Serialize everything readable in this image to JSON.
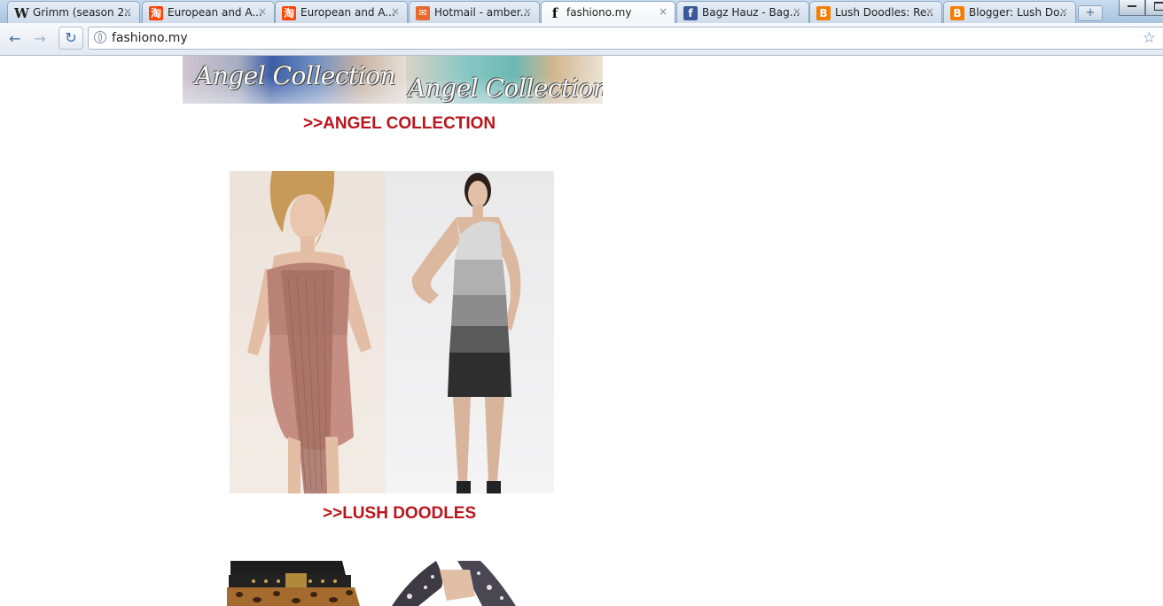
{
  "browser": {
    "tabs": [
      {
        "title": "Grimm (season 2...",
        "favicon": "wikipedia-icon",
        "fav_text": "W",
        "active": false
      },
      {
        "title": "European and A...",
        "favicon": "taobao-icon",
        "fav_text": "淘",
        "active": false
      },
      {
        "title": "European and A...",
        "favicon": "taobao-icon",
        "fav_text": "淘",
        "active": false
      },
      {
        "title": "Hotmail - amber...",
        "favicon": "hotmail-icon",
        "fav_text": "✉",
        "active": false
      },
      {
        "title": "fashiono.my",
        "favicon": "fashiono-icon",
        "fav_text": "f",
        "active": true
      },
      {
        "title": "Bagz Hauz - Bag...",
        "favicon": "facebook-icon",
        "fav_text": "f",
        "active": false
      },
      {
        "title": "Lush Doodles: Re...",
        "favicon": "blogger-icon",
        "fav_text": "B",
        "active": false
      },
      {
        "title": "Blogger: Lush Do...",
        "favicon": "blogger-icon",
        "fav_text": "B",
        "active": false
      }
    ],
    "close_glyph": "×",
    "new_tab_glyph": "+",
    "url": "fashiono.my",
    "colors": {
      "facebook": "#3b5998",
      "blogger": "#f57d00",
      "taobao": "#ff4400",
      "hotmail": "#e8692c"
    }
  },
  "page": {
    "banners": [
      {
        "script_text": "Angel Collection"
      },
      {
        "script_text": "Angel Collection"
      }
    ],
    "links": {
      "angel": ">>ANGEL COLLECTION",
      "lush": ">>LUSH DOODLES"
    },
    "link_color": "#b8161c"
  }
}
